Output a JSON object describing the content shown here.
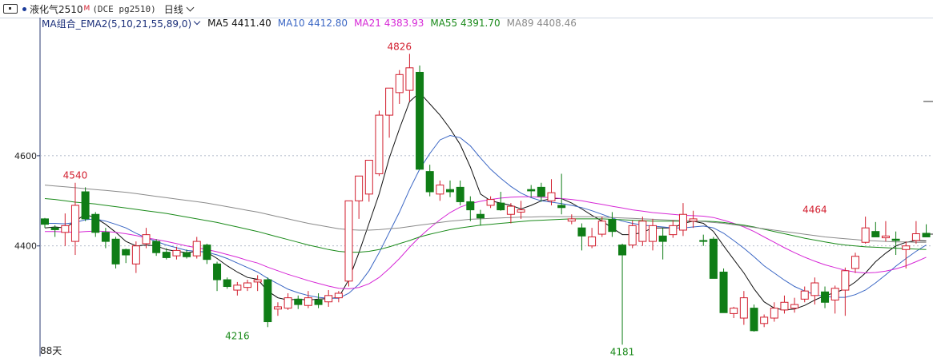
{
  "header": {
    "symbol": "液化气2510",
    "suffix": "M",
    "code": "(DCE pg2510)",
    "period": "日线"
  },
  "indicator": {
    "name": "MA组合_EMA2(5,10,21,55,89,0)",
    "items": [
      {
        "label": "MA5 4411.40",
        "color": "#111111"
      },
      {
        "label": "MA10 4412.80",
        "color": "#3a66c4"
      },
      {
        "label": "MA21 4383.93",
        "color": "#d627d6"
      },
      {
        "label": "MA55 4391.70",
        "color": "#1a8a1a"
      },
      {
        "label": "MA89 4408.46",
        "color": "#8a8a8a"
      }
    ]
  },
  "footer": {
    "bars_label": "88天"
  },
  "chart_data": {
    "type": "candlestick",
    "y_ticks": [
      4400,
      4600
    ],
    "ylim": [
      4155,
      4878
    ],
    "annotations": [
      {
        "text": "4826",
        "bar": 35,
        "value": 4826,
        "pos": "above",
        "color": "#d21e2e"
      },
      {
        "text": "4540",
        "bar": 3,
        "value": 4540,
        "pos": "above",
        "color": "#d21e2e"
      },
      {
        "text": "4464",
        "bar": 76,
        "value": 4464,
        "pos": "above",
        "color": "#d21e2e"
      },
      {
        "text": "4216",
        "bar": 19,
        "value": 4216,
        "pos": "below",
        "color": "#1a8a1a"
      },
      {
        "text": "4181",
        "bar": 57,
        "value": 4181,
        "pos": "below",
        "color": "#1a8a1a"
      }
    ],
    "up_color": "#d21e2e",
    "down_color": "#0f7d16",
    "ohlc": [
      [
        4460,
        4462,
        4440,
        4448
      ],
      [
        4440,
        4446,
        4420,
        4436
      ],
      [
        4430,
        4472,
        4400,
        4445
      ],
      [
        4410,
        4540,
        4380,
        4490
      ],
      [
        4520,
        4530,
        4455,
        4460
      ],
      [
        4470,
        4475,
        4420,
        4430
      ],
      [
        4430,
        4440,
        4395,
        4410
      ],
      [
        4415,
        4420,
        4350,
        4360
      ],
      [
        4392,
        4394,
        4362,
        4380
      ],
      [
        4360,
        4410,
        4340,
        4400
      ],
      [
        4405,
        4440,
        4395,
        4425
      ],
      [
        4410,
        4415,
        4378,
        4385
      ],
      [
        4386,
        4395,
        4370,
        4374
      ],
      [
        4378,
        4398,
        4370,
        4390
      ],
      [
        4385,
        4392,
        4372,
        4376
      ],
      [
        4378,
        4420,
        4372,
        4410
      ],
      [
        4402,
        4405,
        4360,
        4370
      ],
      [
        4360,
        4365,
        4300,
        4325
      ],
      [
        4325,
        4330,
        4305,
        4310
      ],
      [
        4302,
        4320,
        4290,
        4313
      ],
      [
        4308,
        4325,
        4300,
        4318
      ],
      [
        4320,
        4335,
        4300,
        4325
      ],
      [
        4325,
        4330,
        4220,
        4232
      ],
      [
        4260,
        4275,
        4245,
        4265
      ],
      [
        4262,
        4295,
        4258,
        4285
      ],
      [
        4282,
        4290,
        4260,
        4270
      ],
      [
        4268,
        4300,
        4262,
        4285
      ],
      [
        4280,
        4295,
        4262,
        4270
      ],
      [
        4276,
        4302,
        4265,
        4290
      ],
      [
        4285,
        4300,
        4275,
        4295
      ],
      [
        4322,
        4500,
        4310,
        4500
      ],
      [
        4500,
        4555,
        4460,
        4555
      ],
      [
        4515,
        4590,
        4498,
        4590
      ],
      [
        4560,
        4700,
        4555,
        4690
      ],
      [
        4690,
        4750,
        4640,
        4750
      ],
      [
        4740,
        4790,
        4715,
        4780
      ],
      [
        4745,
        4826,
        4720,
        4795
      ],
      [
        4785,
        4800,
        4570,
        4570
      ],
      [
        4565,
        4580,
        4510,
        4520
      ],
      [
        4515,
        4545,
        4500,
        4535
      ],
      [
        4525,
        4545,
        4508,
        4520
      ],
      [
        4530,
        4545,
        4490,
        4498
      ],
      [
        4498,
        4510,
        4455,
        4480
      ],
      [
        4470,
        4480,
        4445,
        4462
      ],
      [
        4490,
        4510,
        4484,
        4503
      ],
      [
        4495,
        4520,
        4478,
        4480
      ],
      [
        4470,
        4495,
        4450,
        4488
      ],
      [
        4475,
        4500,
        4460,
        4480
      ],
      [
        4525,
        4535,
        4508,
        4522
      ],
      [
        4530,
        4540,
        4498,
        4510
      ],
      [
        4500,
        4548,
        4490,
        4518
      ],
      [
        4490,
        4560,
        4470,
        4485
      ],
      [
        4455,
        4470,
        4448,
        4460
      ],
      [
        4440,
        4450,
        4390,
        4422
      ],
      [
        4400,
        4440,
        4395,
        4420
      ],
      [
        4426,
        4465,
        4420,
        4455
      ],
      [
        4458,
        4475,
        4420,
        4432
      ],
      [
        4402,
        4405,
        4181,
        4380
      ],
      [
        4402,
        4456,
        4395,
        4445
      ],
      [
        4410,
        4465,
        4400,
        4455
      ],
      [
        4410,
        4460,
        4390,
        4445
      ],
      [
        4422,
        4440,
        4370,
        4410
      ],
      [
        4425,
        4457,
        4418,
        4445
      ],
      [
        4435,
        4495,
        4422,
        4470
      ],
      [
        4455,
        4478,
        4440,
        4460
      ],
      [
        4412,
        4425,
        4400,
        4410
      ],
      [
        4415,
        4420,
        4330,
        4328
      ],
      [
        4342,
        4350,
        4255,
        4252
      ],
      [
        4250,
        4265,
        4240,
        4262
      ],
      [
        4240,
        4300,
        4225,
        4285
      ],
      [
        4262,
        4270,
        4210,
        4212
      ],
      [
        4228,
        4248,
        4220,
        4242
      ],
      [
        4240,
        4275,
        4232,
        4262
      ],
      [
        4258,
        4290,
        4250,
        4275
      ],
      [
        4262,
        4285,
        4252,
        4270
      ],
      [
        4282,
        4310,
        4275,
        4300
      ],
      [
        4290,
        4330,
        4270,
        4318
      ],
      [
        4298,
        4310,
        4262,
        4275
      ],
      [
        4280,
        4312,
        4250,
        4306
      ],
      [
        4302,
        4352,
        4245,
        4345
      ],
      [
        4350,
        4385,
        4340,
        4377
      ],
      [
        4408,
        4465,
        4405,
        4440
      ],
      [
        4432,
        4453,
        4420,
        4420
      ],
      [
        4418,
        4455,
        4410,
        4422
      ],
      [
        4415,
        4432,
        4380,
        4412
      ],
      [
        4392,
        4410,
        4350,
        4400
      ],
      [
        4412,
        4455,
        4405,
        4427
      ],
      [
        4428,
        4448,
        4422,
        4420
      ]
    ],
    "series": [
      {
        "name": "MA5",
        "color": "#111111",
        "width": 1.0,
        "values": [
          4440,
          4442,
          4440,
          4455,
          4470,
          4462,
          4448,
          4430,
          4410,
          4400,
          4402,
          4400,
          4392,
          4388,
          4385,
          4388,
          4386,
          4372,
          4356,
          4342,
          4330,
          4326,
          4300,
          4285,
          4280,
          4282,
          4280,
          4282,
          4283,
          4286,
          4325,
          4385,
          4450,
          4515,
          4595,
          4660,
          4720,
          4740,
          4715,
          4690,
          4660,
          4625,
          4575,
          4515,
          4500,
          4495,
          4490,
          4482,
          4490,
          4500,
          4505,
          4505,
          4495,
          4482,
          4468,
          4455,
          4440,
          4425,
          4425,
          4430,
          4440,
          4440,
          4440,
          4450,
          4455,
          4450,
          4432,
          4400,
          4370,
          4340,
          4305,
          4276,
          4262,
          4258,
          4260,
          4268,
          4280,
          4290,
          4296,
          4305,
          4320,
          4340,
          4365,
          4384,
          4400,
          4408,
          4412,
          4411
        ]
      },
      {
        "name": "MA10",
        "color": "#3a66c4",
        "width": 1.0,
        "values": [
          4450,
          4450,
          4449,
          4452,
          4458,
          4460,
          4455,
          4448,
          4440,
          4428,
          4418,
          4410,
          4402,
          4396,
          4390,
          4388,
          4386,
          4380,
          4372,
          4362,
          4352,
          4342,
          4328,
          4316,
          4304,
          4296,
          4290,
          4286,
          4284,
          4284,
          4295,
          4315,
          4345,
          4385,
          4430,
          4475,
          4525,
          4570,
          4605,
          4635,
          4645,
          4640,
          4622,
          4595,
          4570,
          4550,
          4532,
          4517,
          4507,
          4500,
          4497,
          4494,
          4490,
          4485,
          4478,
          4470,
          4462,
          4455,
          4450,
          4446,
          4444,
          4442,
          4440,
          4440,
          4442,
          4444,
          4440,
          4428,
          4412,
          4395,
          4376,
          4356,
          4340,
          4324,
          4310,
          4300,
          4292,
          4288,
          4286,
          4286,
          4292,
          4302,
          4318,
          4336,
          4355,
          4372,
          4388,
          4402
        ]
      },
      {
        "name": "MA21",
        "color": "#d627d6",
        "width": 1.0,
        "values": [
          4432,
          4432,
          4431,
          4430,
          4432,
          4433,
          4432,
          4430,
          4427,
          4423,
          4418,
          4414,
          4410,
          4405,
          4400,
          4396,
          4392,
          4387,
          4381,
          4375,
          4368,
          4362,
          4353,
          4345,
          4337,
          4330,
          4323,
          4317,
          4311,
          4306,
          4305,
          4308,
          4316,
          4330,
          4350,
          4372,
          4397,
          4420,
          4440,
          4458,
          4474,
          4486,
          4494,
          4499,
          4503,
          4506,
          4508,
          4509,
          4509,
          4508,
          4507,
          4505,
          4503,
          4500,
          4496,
          4492,
          4488,
          4484,
          4480,
          4477,
          4474,
          4472,
          4470,
          4468,
          4467,
          4466,
          4463,
          4457,
          4450,
          4442,
          4432,
          4420,
          4408,
          4396,
          4385,
          4375,
          4366,
          4358,
          4352,
          4346,
          4342,
          4340,
          4341,
          4344,
          4349,
          4356,
          4365,
          4375
        ]
      },
      {
        "name": "MA55",
        "color": "#1a8a1a",
        "width": 1.0,
        "values": [
          4505,
          4503,
          4500,
          4497,
          4495,
          4493,
          4490,
          4487,
          4484,
          4481,
          4478,
          4475,
          4472,
          4468,
          4464,
          4460,
          4456,
          4452,
          4447,
          4442,
          4437,
          4432,
          4426,
          4420,
          4414,
          4408,
          4402,
          4397,
          4392,
          4388,
          4386,
          4386,
          4388,
          4392,
          4398,
          4405,
          4412,
          4420,
          4426,
          4431,
          4436,
          4440,
          4443,
          4446,
          4448,
          4450,
          4452,
          4454,
          4456,
          4457,
          4458,
          4459,
          4460,
          4460,
          4460,
          4460,
          4459,
          4458,
          4457,
          4456,
          4455,
          4455,
          4455,
          4455,
          4455,
          4455,
          4454,
          4452,
          4449,
          4446,
          4442,
          4437,
          4432,
          4427,
          4422,
          4417,
          4413,
          4409,
          4405,
          4402,
          4400,
          4398,
          4397,
          4396,
          4395,
          4394,
          4393,
          4392
        ]
      },
      {
        "name": "MA89",
        "color": "#8a8a8a",
        "width": 1.0,
        "values": [
          4535,
          4533,
          4531,
          4529,
          4527,
          4525,
          4523,
          4521,
          4519,
          4516,
          4513,
          4510,
          4507,
          4504,
          4501,
          4498,
          4495,
          4491,
          4487,
          4483,
          4479,
          4475,
          4470,
          4465,
          4460,
          4455,
          4450,
          4446,
          4442,
          4438,
          4436,
          4435,
          4435,
          4436,
          4438,
          4440,
          4443,
          4446,
          4449,
          4452,
          4455,
          4457,
          4459,
          4460,
          4461,
          4462,
          4463,
          4464,
          4464,
          4465,
          4465,
          4465,
          4465,
          4465,
          4465,
          4464,
          4463,
          4462,
          4461,
          4460,
          4459,
          4458,
          4457,
          4456,
          4455,
          4454,
          4452,
          4450,
          4447,
          4444,
          4441,
          4438,
          4435,
          4432,
          4429,
          4426,
          4423,
          4420,
          4418,
          4416,
          4414,
          4412,
          4411,
          4410,
          4409,
          4409,
          4408,
          4408
        ]
      }
    ]
  }
}
